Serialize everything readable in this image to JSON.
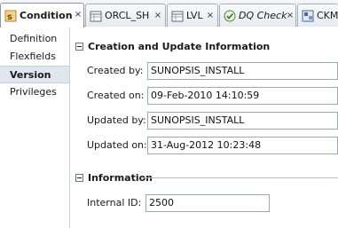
{
  "tabs": [
    {
      "label": "Condition",
      "icon": "condition-icon",
      "close": "×",
      "active": true
    },
    {
      "label": "ORCL_SH",
      "icon": "datastore-icon",
      "close": "×",
      "active": false
    },
    {
      "label": "LVL",
      "icon": "datastore-icon",
      "close": "×",
      "active": false
    },
    {
      "label": "DQ Check",
      "icon": "dq-check-icon",
      "close": "×",
      "active": false
    },
    {
      "label": "CKM",
      "icon": "ckm-icon",
      "close": "",
      "active": false
    }
  ],
  "nav": {
    "items": [
      "Definition",
      "Flexfields",
      "Version",
      "Privileges"
    ],
    "selected": "Version"
  },
  "sections": {
    "creation": {
      "title": "Creation and Update Information",
      "created_by_label": "Created by:",
      "created_by": "SUNOPSIS_INSTALL",
      "created_on_label": "Created on:",
      "created_on": "09-Feb-2010 14:10:59",
      "updated_by_label": "Updated by:",
      "updated_by": "SUNOPSIS_INSTALL",
      "updated_on_label": "Updated on:",
      "updated_on": "31-Aug-2012 10:23:48"
    },
    "information": {
      "title": "Information",
      "internal_id_label": "Internal ID:",
      "internal_id": "2500"
    }
  }
}
